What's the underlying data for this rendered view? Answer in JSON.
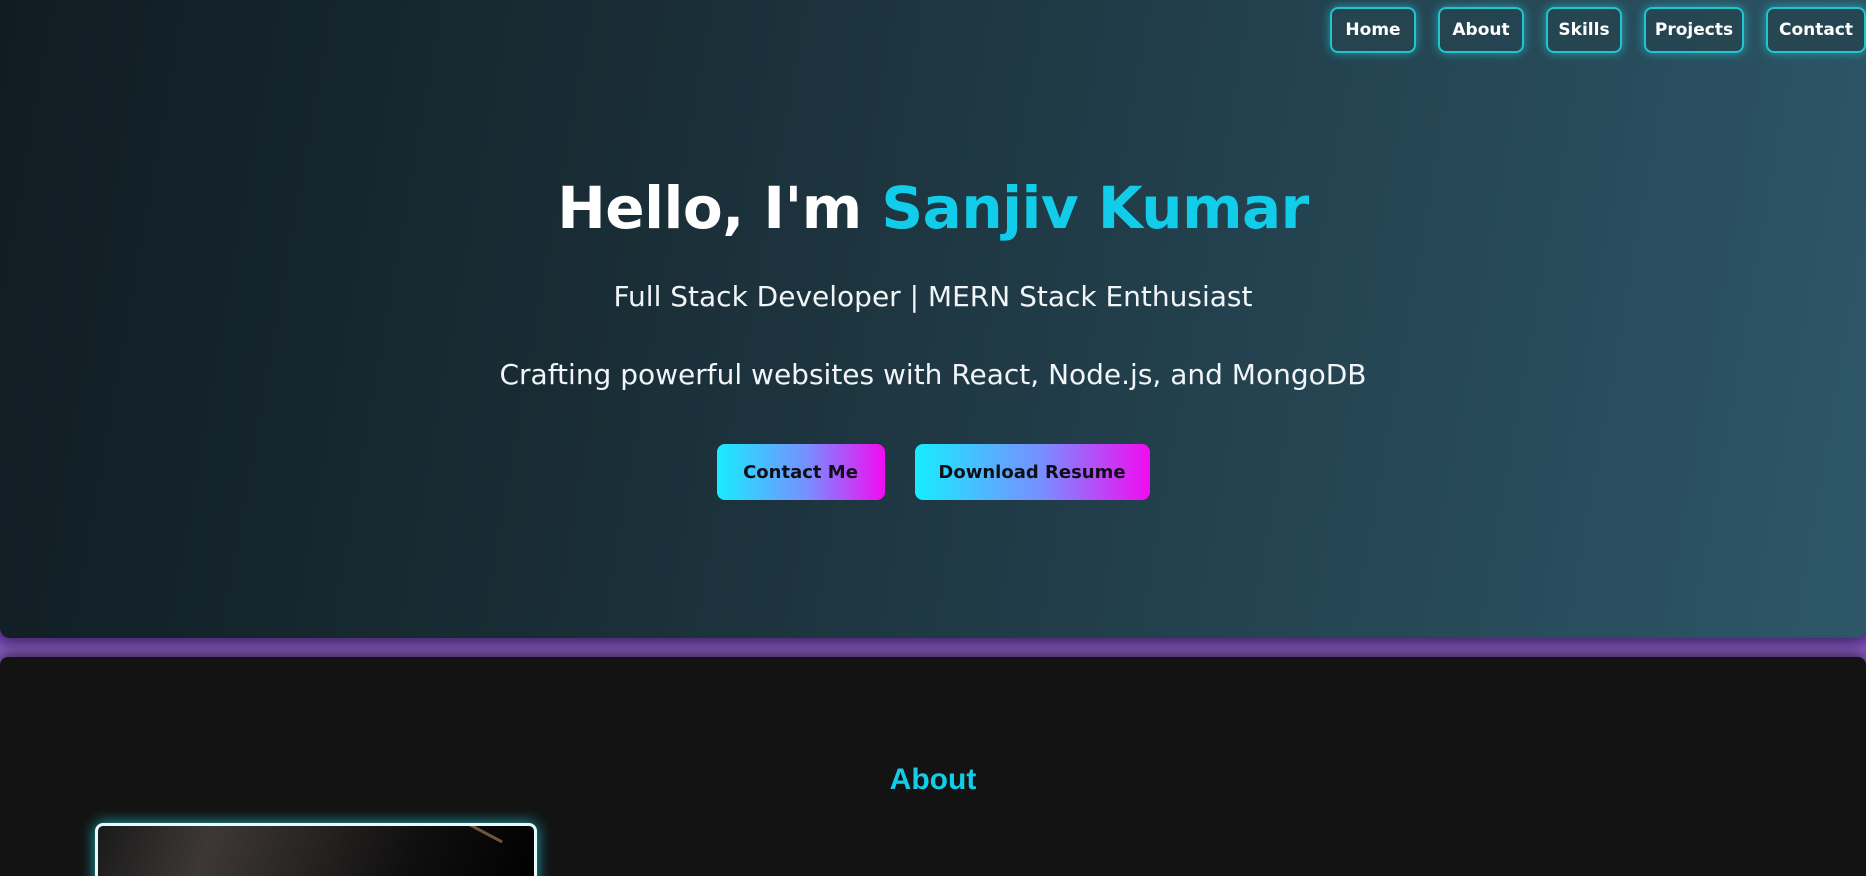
{
  "nav": {
    "items": [
      {
        "label": "Home"
      },
      {
        "label": "About"
      },
      {
        "label": "Skills"
      },
      {
        "label": "Projects"
      },
      {
        "label": "Contact"
      }
    ]
  },
  "hero": {
    "greeting": "Hello, I'm ",
    "name": "Sanjiv Kumar",
    "role": "Full Stack Developer | MERN Stack Enthusiast",
    "tagline": "Crafting powerful websites with React, Node.js, and MongoDB",
    "contact_label": "Contact Me",
    "resume_label": "Download Resume"
  },
  "about": {
    "title": "About"
  },
  "colors": {
    "accent": "#12cdea",
    "nav_border": "#21c5cf",
    "gradient_start": "#18ecff",
    "gradient_end": "#f20bf0",
    "section_bg": "#131313"
  }
}
